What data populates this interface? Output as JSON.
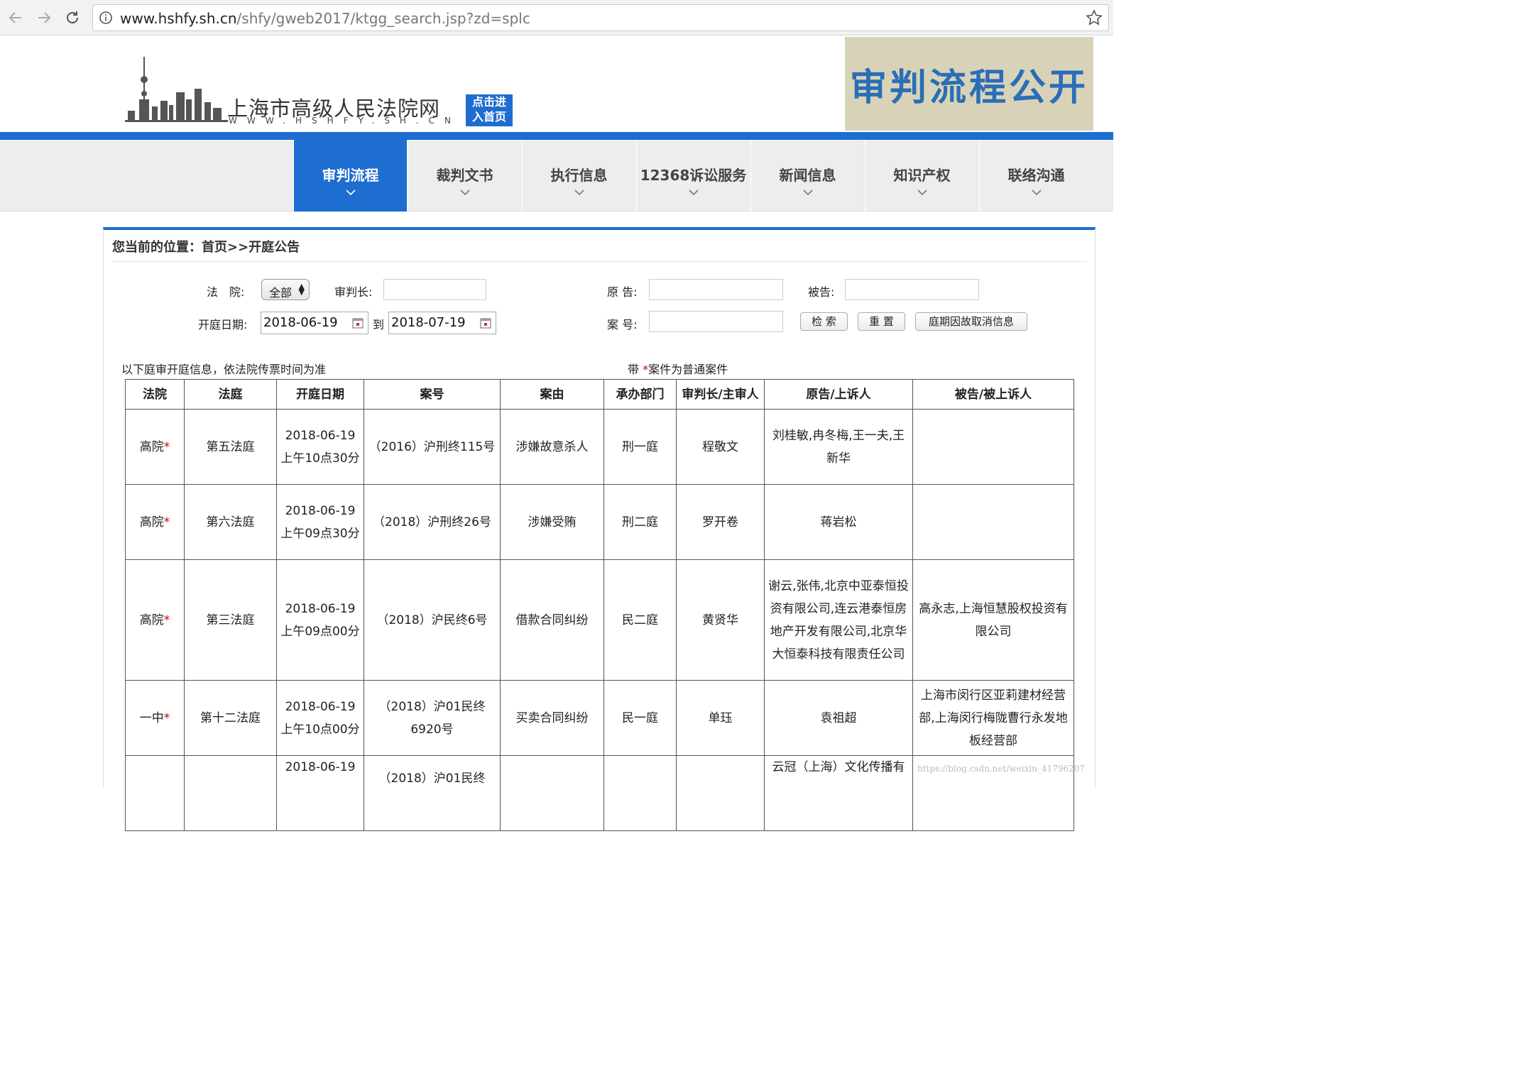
{
  "browser": {
    "url_host": "www.hshfy.sh.cn",
    "url_path": "/shfy/gweb2017/ktgg_search.jsp?zd=splc"
  },
  "header": {
    "logo_cn": "上海市高级人民法院网",
    "logo_en": "WWW.HSHFY.SH.CN",
    "home_line1": "点击进",
    "home_line2": "入首页",
    "banner": "审判流程公开"
  },
  "nav": {
    "items": [
      {
        "label": "审判流程"
      },
      {
        "label": "裁判文书"
      },
      {
        "label": "执行信息"
      },
      {
        "label": "12368诉讼服务"
      },
      {
        "label": "新闻信息"
      },
      {
        "label": "知识产权"
      },
      {
        "label": "联络沟通"
      }
    ]
  },
  "breadcrumb": "您当前的位置：首页>>开庭公告",
  "form": {
    "court_label": "法　院:",
    "court_value": "全部",
    "judge_label": "审判长:",
    "judge_value": "",
    "plaintiff_label": "原 告:",
    "plaintiff_value": "",
    "defendant_label": "被告:",
    "defendant_value": "",
    "date_label": "开庭日期:",
    "date_from": "2018-06-19",
    "date_to_label": "到",
    "date_to": "2018-07-19",
    "case_no_label": "案 号:",
    "case_no_value": "",
    "search_btn": "检 索",
    "reset_btn": "重 置",
    "cancel_btn": "庭期因故取消信息"
  },
  "notes": {
    "left": "以下庭审开庭信息，依法院传票时间为准",
    "right_prefix": "带 ",
    "right_star": "*",
    "right_suffix": "案件为普通案件"
  },
  "table": {
    "headers": [
      "法院",
      "法庭",
      "开庭日期",
      "案号",
      "案由",
      "承办部门",
      "审判长/主审人",
      "原告/上诉人",
      "被告/被上诉人"
    ],
    "rows": [
      {
        "court": "高院",
        "star": "*",
        "room": "第五法庭",
        "date": "2018-06-19 上午10点30分",
        "case_no": "（2016）沪刑终115号",
        "cause": "涉嫌故意杀人",
        "dept": "刑一庭",
        "judge": "程敬文",
        "plaintiff": "刘桂敏,冉冬梅,王一夫,王新华",
        "defendant": ""
      },
      {
        "court": "高院",
        "star": "*",
        "room": "第六法庭",
        "date": "2018-06-19 上午09点30分",
        "case_no": "（2018）沪刑终26号",
        "cause": "涉嫌受贿",
        "dept": "刑二庭",
        "judge": "罗开卷",
        "plaintiff": "蒋岩松",
        "defendant": ""
      },
      {
        "court": "高院",
        "star": "*",
        "room": "第三法庭",
        "date": "2018-06-19 上午09点00分",
        "case_no": "（2018）沪民终6号",
        "cause": "借款合同纠纷",
        "dept": "民二庭",
        "judge": "黄贤华",
        "plaintiff": "谢云,张伟,北京中亚泰恒投资有限公司,连云港泰恒房地产开发有限公司,北京华大恒泰科技有限责任公司",
        "defendant": "高永志,上海恒慧股权投资有限公司"
      },
      {
        "court": "一中",
        "star": "*",
        "room": "第十二法庭",
        "date": "2018-06-19 上午10点00分",
        "case_no": "（2018）沪01民终6920号",
        "cause": "买卖合同纠纷",
        "dept": "民一庭",
        "judge": "单珏",
        "plaintiff": "袁祖超",
        "defendant": "上海市闵行区亚莉建材经营部,上海闵行梅陇曹行永发地板经营部"
      },
      {
        "court": "",
        "star": "",
        "room": "",
        "date": "2018-06-19",
        "case_no": "（2018）沪01民终",
        "cause": "",
        "dept": "",
        "judge": "",
        "plaintiff": "云冠（上海）文化传播有",
        "defendant": ""
      }
    ]
  },
  "watermark": "https://blog.csdn.net/weixin_41796207",
  "colors": {
    "accent": "#1e6dd0",
    "banner_bg": "#d8d3b8",
    "banner_text": "#2a6eb8",
    "star": "#cc0000"
  }
}
